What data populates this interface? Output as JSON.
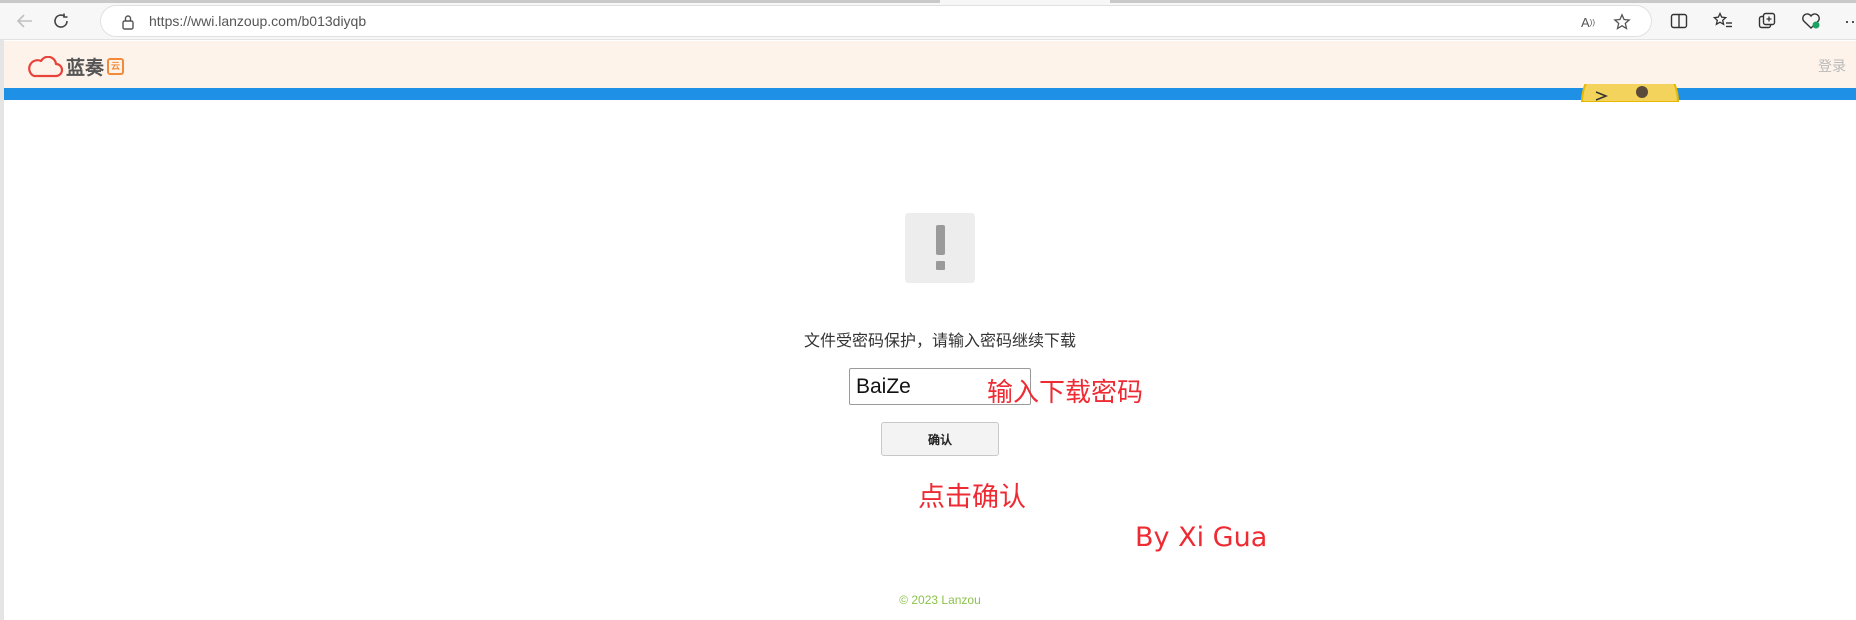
{
  "browser": {
    "url": "https://wwi.lanzoup.com/b013diyqb",
    "icons": [
      "back-arrow-icon",
      "refresh-icon",
      "lock-icon",
      "read-aloud-icon",
      "favorite-star-icon",
      "split-screen-icon",
      "favorites-list-icon",
      "collections-icon",
      "browser-essentials-icon",
      "more-icon"
    ]
  },
  "site": {
    "logo_text": "蓝奏",
    "logo_badge": "云",
    "login": "登录",
    "accent": "#1e90e6"
  },
  "main": {
    "prompt": "文件受密码保护，请输入密码继续下载",
    "password_value": "BaiZe",
    "confirm_label": "确认",
    "footer": "© 2023 Lanzou"
  },
  "annotations": {
    "input_hint": "输入下载密码",
    "click_hint": "点击确认",
    "credit": "By Xi Gua",
    "color": "#ee2b33"
  }
}
